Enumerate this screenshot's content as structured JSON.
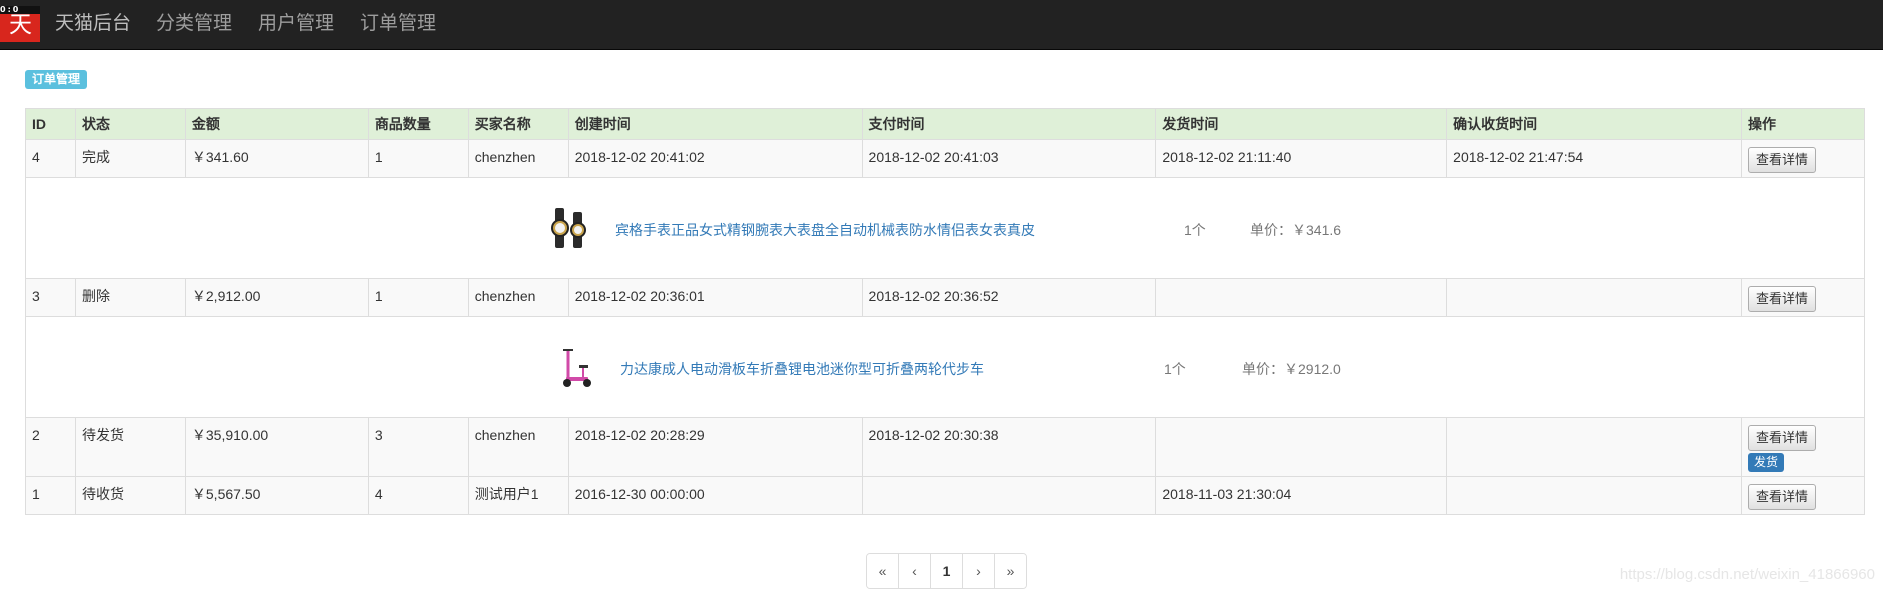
{
  "nav": {
    "logo_top": "0:0",
    "logo_text": "天猫",
    "brand": "天猫后台",
    "items": [
      "分类管理",
      "用户管理",
      "订单管理"
    ]
  },
  "page_label": "订单管理",
  "table": {
    "headers": [
      "ID",
      "状态",
      "金额",
      "商品数量",
      "买家名称",
      "创建时间",
      "支付时间",
      "发货时间",
      "确认收货时间",
      "操作"
    ],
    "view_label": "查看详情",
    "ship_label": "发货",
    "rows": [
      {
        "id": "4",
        "status": "完成",
        "amount": "￥341.60",
        "count": "1",
        "buyer": "chenzhen",
        "created": "2018-12-02 20:41:02",
        "paid": "2018-12-02 20:41:03",
        "shipped": "2018-12-02 21:11:40",
        "confirmed": "2018-12-02 21:47:54",
        "detail": {
          "name": "宾格手表正品女式精钢腕表大表盘全自动机械表防水情侣表女表真皮",
          "qty": "1个",
          "price": "单价：￥341.6"
        }
      },
      {
        "id": "3",
        "status": "删除",
        "amount": "￥2,912.00",
        "count": "1",
        "buyer": "chenzhen",
        "created": "2018-12-02 20:36:01",
        "paid": "2018-12-02 20:36:52",
        "shipped": "",
        "confirmed": "",
        "detail": {
          "name": "力达康成人电动滑板车折叠锂电池迷你型可折叠两轮代步车",
          "qty": "1个",
          "price": "单价：￥2912.0"
        }
      },
      {
        "id": "2",
        "status": "待发货",
        "amount": "￥35,910.00",
        "count": "3",
        "buyer": "chenzhen",
        "created": "2018-12-02 20:28:29",
        "paid": "2018-12-02 20:30:38",
        "shipped": "",
        "confirmed": ""
      },
      {
        "id": "1",
        "status": "待收货",
        "amount": "￥5,567.50",
        "count": "4",
        "buyer": "测试用户1",
        "created": "2016-12-30 00:00:00",
        "paid": "",
        "shipped": "2018-11-03 21:30:04",
        "confirmed": ""
      }
    ]
  },
  "pagination": [
    "«",
    "‹",
    "1",
    "›",
    "»"
  ],
  "watermark": "https://blog.csdn.net/weixin_41866960",
  "colors": {
    "navbar": "#222222",
    "logo": "#d8261d",
    "header_row": "#dff0d8",
    "label": "#5bc0de",
    "primary": "#337ab7"
  }
}
